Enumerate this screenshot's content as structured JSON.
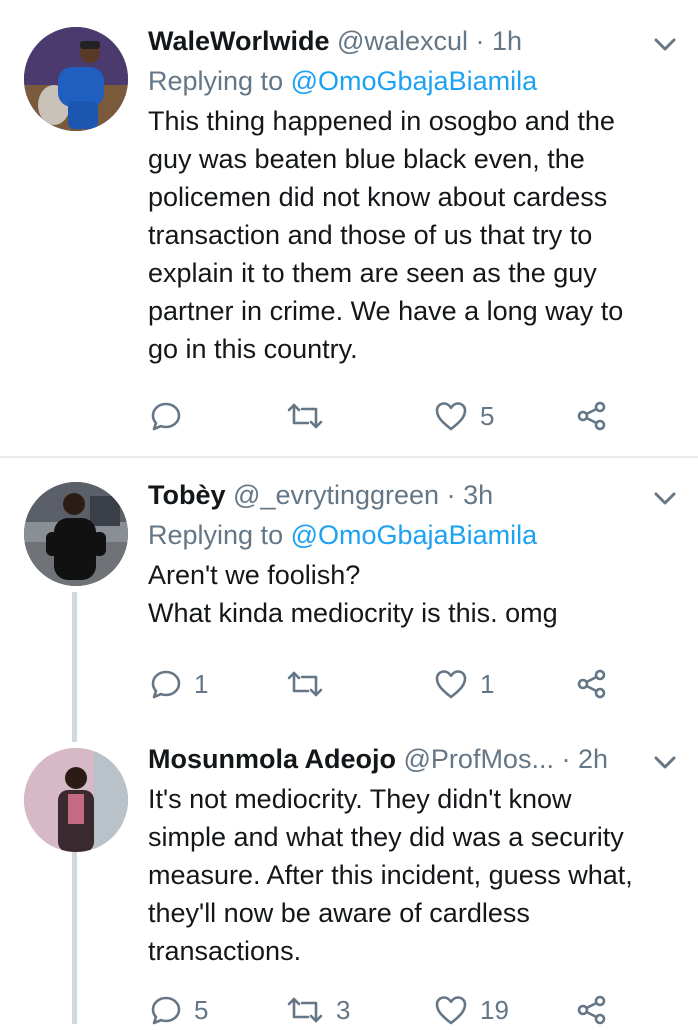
{
  "tweets": [
    {
      "name": "WaleWorlwide",
      "handle": "@walexcul",
      "time": "· 1h",
      "replying_prefix": "Replying to",
      "replying_to": "@OmoGbajaBiamila",
      "text": "This thing happened in osogbo and the\nguy was beaten blue black even,  the\npolicemen did not know about cardess\ntransaction and those of us that try to\nexplain it to them are seen as the guy\npartner in crime. We have a long way to\ngo in this country.",
      "reply_count": "",
      "retweet_count": "",
      "like_count": "5"
    },
    {
      "name": "Tobèy",
      "handle": "@_evrytinggreen",
      "time": "· 3h",
      "replying_prefix": "Replying to",
      "replying_to": "@OmoGbajaBiamila",
      "text": "Aren't we foolish?\nWhat kinda mediocrity is this. omg",
      "reply_count": "1",
      "retweet_count": "",
      "like_count": "1"
    },
    {
      "name": "Mosunmola Adeojo",
      "handle": "@ProfMos...",
      "time": "· 2h",
      "text": "It's not mediocrity. They didn't know\nsimple and what they did was a security\nmeasure. After this incident, guess what,\nthey'll now be aware of cardless\ntransactions.",
      "reply_count": "5",
      "retweet_count": "3",
      "like_count": "19"
    }
  ],
  "colors": {
    "text": "#14171a",
    "secondary": "#657786",
    "link": "#1da1f2",
    "divider": "#e6ecf0",
    "thread": "#cfd9de"
  },
  "icons": [
    "reply-icon",
    "retweet-icon",
    "like-icon",
    "share-icon",
    "chevron-down-icon"
  ]
}
